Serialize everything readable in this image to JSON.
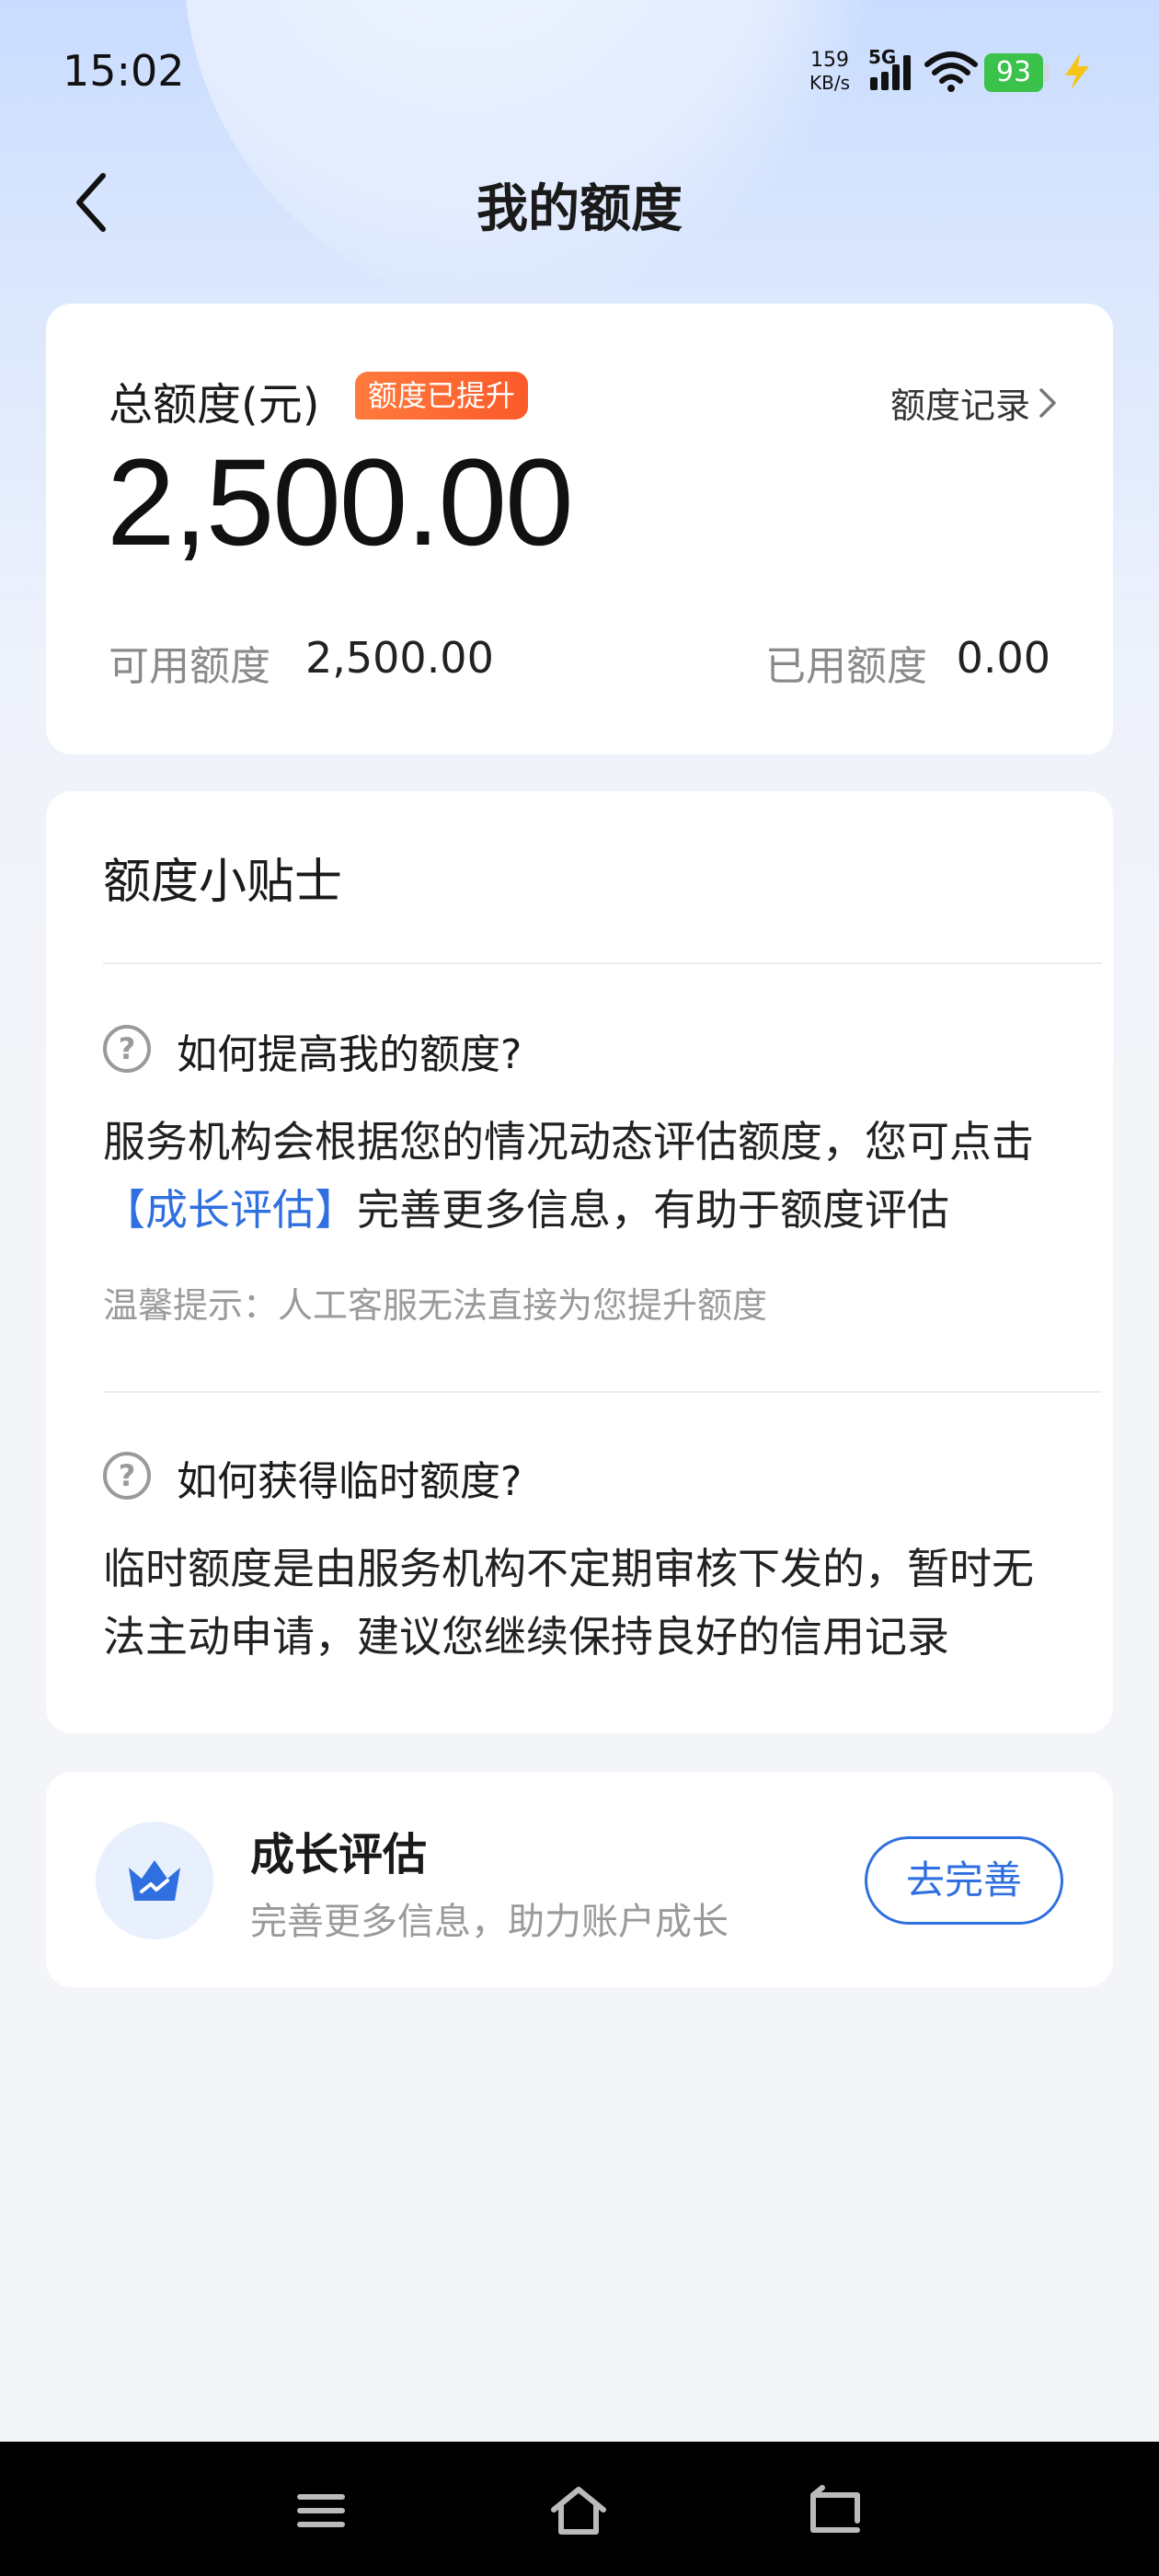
{
  "status_bar": {
    "time": "15:02",
    "net_speed_value": "159",
    "net_speed_unit": "KB/s",
    "network": "5G",
    "battery": "93"
  },
  "header": {
    "title": "我的额度",
    "back_icon": "chevron-left-icon"
  },
  "quota_card": {
    "label": "总额度(元)",
    "badge": "额度已提升",
    "record_link": "额度记录",
    "total": "2,500.00",
    "available_label": "可用额度",
    "available_value": "2,500.00",
    "used_label": "已用额度",
    "used_value": "0.00"
  },
  "tips": {
    "title": "额度小贴士",
    "items": [
      {
        "question": "如何提高我的额度?",
        "answer_prefix": "服务机构会根据您的情况动态评估额度，您可点击",
        "answer_link": "【成长评估】",
        "answer_suffix": "完善更多信息，有助于额度评估",
        "hint": "温馨提示：人工客服无法直接为您提升额度"
      },
      {
        "question": "如何获得临时额度?",
        "answer_line1": "临时额度是由服务机构不定期审核下发的，暂时无",
        "answer_line2": "法主动申请，建议您继续保持良好的信用记录"
      }
    ]
  },
  "growth": {
    "title": "成长评估",
    "subtitle": "完善更多信息，助力账户成长",
    "button": "去完善"
  },
  "colors": {
    "accent": "#2f6fe0",
    "badge": "#fb5a2a",
    "battery": "#3ac24a"
  }
}
